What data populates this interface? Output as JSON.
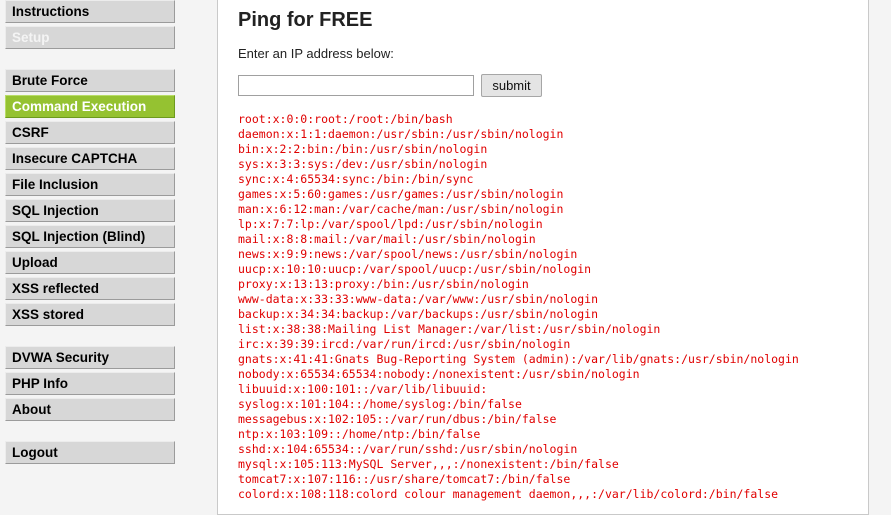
{
  "menu": {
    "group1": [
      {
        "label": "Instructions",
        "state": "normal"
      },
      {
        "label": "Setup",
        "state": "disabled"
      }
    ],
    "group2": [
      {
        "label": "Brute Force",
        "state": "normal"
      },
      {
        "label": "Command Execution",
        "state": "selected"
      },
      {
        "label": "CSRF",
        "state": "normal"
      },
      {
        "label": "Insecure CAPTCHA",
        "state": "normal"
      },
      {
        "label": "File Inclusion",
        "state": "normal"
      },
      {
        "label": "SQL Injection",
        "state": "normal"
      },
      {
        "label": "SQL Injection (Blind)",
        "state": "normal"
      },
      {
        "label": "Upload",
        "state": "normal"
      },
      {
        "label": "XSS reflected",
        "state": "normal"
      },
      {
        "label": "XSS stored",
        "state": "normal"
      }
    ],
    "group3": [
      {
        "label": "DVWA Security",
        "state": "normal"
      },
      {
        "label": "PHP Info",
        "state": "normal"
      },
      {
        "label": "About",
        "state": "normal"
      }
    ],
    "group4": [
      {
        "label": "Logout",
        "state": "normal"
      }
    ]
  },
  "main": {
    "title": "Ping for FREE",
    "prompt": "Enter an IP address below:",
    "ip_value": "",
    "submit_label": "submit",
    "output_lines": [
      "root:x:0:0:root:/root:/bin/bash",
      "daemon:x:1:1:daemon:/usr/sbin:/usr/sbin/nologin",
      "bin:x:2:2:bin:/bin:/usr/sbin/nologin",
      "sys:x:3:3:sys:/dev:/usr/sbin/nologin",
      "sync:x:4:65534:sync:/bin:/bin/sync",
      "games:x:5:60:games:/usr/games:/usr/sbin/nologin",
      "man:x:6:12:man:/var/cache/man:/usr/sbin/nologin",
      "lp:x:7:7:lp:/var/spool/lpd:/usr/sbin/nologin",
      "mail:x:8:8:mail:/var/mail:/usr/sbin/nologin",
      "news:x:9:9:news:/var/spool/news:/usr/sbin/nologin",
      "uucp:x:10:10:uucp:/var/spool/uucp:/usr/sbin/nologin",
      "proxy:x:13:13:proxy:/bin:/usr/sbin/nologin",
      "www-data:x:33:33:www-data:/var/www:/usr/sbin/nologin",
      "backup:x:34:34:backup:/var/backups:/usr/sbin/nologin",
      "list:x:38:38:Mailing List Manager:/var/list:/usr/sbin/nologin",
      "irc:x:39:39:ircd:/var/run/ircd:/usr/sbin/nologin",
      "gnats:x:41:41:Gnats Bug-Reporting System (admin):/var/lib/gnats:/usr/sbin/nologin",
      "nobody:x:65534:65534:nobody:/nonexistent:/usr/sbin/nologin",
      "libuuid:x:100:101::/var/lib/libuuid:",
      "syslog:x:101:104::/home/syslog:/bin/false",
      "messagebus:x:102:105::/var/run/dbus:/bin/false",
      "ntp:x:103:109::/home/ntp:/bin/false",
      "sshd:x:104:65534::/var/run/sshd:/usr/sbin/nologin",
      "mysql:x:105:113:MySQL Server,,,:/nonexistent:/bin/false",
      "tomcat7:x:107:116::/usr/share/tomcat7:/bin/false",
      "colord:x:108:118:colord colour management daemon,,,:/var/lib/colord:/bin/false"
    ]
  },
  "colors": {
    "selected_menu": "#95c231",
    "menu_bg": "#d7d7d7",
    "output_text": "#e00000"
  }
}
